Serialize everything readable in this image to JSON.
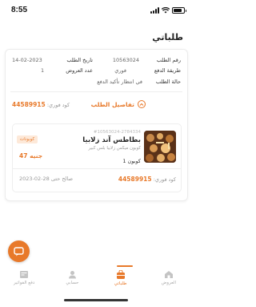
{
  "status_bar": {
    "time": "8:55"
  },
  "header": {
    "title": "طلباتي"
  },
  "order": {
    "number_label": "رقم الطلب",
    "number_value": "10563024",
    "date_label": "تاريخ الطلب",
    "date_value": "14-02-2023",
    "payment_label": "طريقة الدفع",
    "payment_value": "فوري",
    "offers_count_label": "عدد العروض",
    "offers_count_value": "1",
    "status_label": "حالة الطلب",
    "status_value": "في انتظار تأكيد الدفع",
    "details_link": "تفاصيل الطلب",
    "fawry_code_label": "كود فوري:",
    "fawry_code_value": "44589915"
  },
  "product": {
    "code": "#10563024-2784334",
    "name": "بطاطس آند زلابيا",
    "description": "كوبون ميكس زلابيا بلس كبير",
    "quantity": "1 كوبون",
    "badge": "كوبونات",
    "price": "47 جنيه",
    "fawry_code_label": "كود فوري:",
    "fawry_code_value": "44589915",
    "valid_until": "صالح حتى 28-02-2023"
  },
  "nav": {
    "items": [
      {
        "label": "العروض",
        "icon": "home-icon"
      },
      {
        "label": "طلباتي",
        "icon": "orders-bag-icon",
        "active": true
      },
      {
        "label": "حسابي",
        "icon": "user-icon"
      },
      {
        "label": "دفع الفواتير",
        "icon": "bills-icon"
      }
    ]
  },
  "colors": {
    "accent": "#e8792a",
    "badge_bg": "#fde9d9"
  }
}
